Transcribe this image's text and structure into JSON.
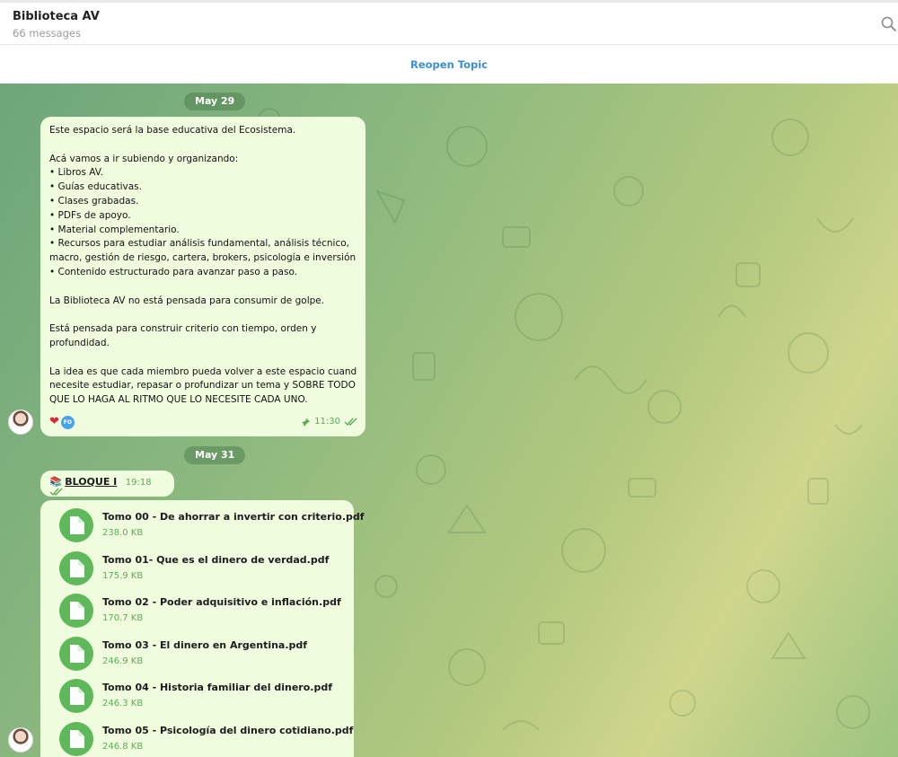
{
  "header": {
    "title": "Biblioteca AV",
    "subtitle": "66 messages"
  },
  "topic": {
    "reopen_label": "Reopen Topic"
  },
  "dates": [
    "May 29",
    "May 31"
  ],
  "message1": {
    "lines": [
      "Este espacio será la base educativa del Ecosistema.",
      "",
      "Acá vamos a ir subiendo y organizando:",
      "• Libros AV.",
      "• Guías educativas.",
      "• Clases grabadas.",
      "• PDFs de apoyo.",
      "• Material complementario.",
      "• Recursos para estudiar análisis fundamental, análisis técnico,",
      "macro, gestión de riesgo, cartera, brokers, psicología e inversión.",
      "• Contenido estructurado para avanzar paso a paso.",
      "",
      "La Biblioteca AV no está pensada para consumir de golpe.",
      "",
      "Está pensada para construir criterio con tiempo, orden y",
      "profundidad.",
      "",
      "La idea es que cada miembro pueda volver a este espacio cuando",
      "necesite estudiar, repasar o profundizar un tema y SOBRE TODO",
      "QUE LO HAGA AL RITMO QUE LO NECESITE CADA UNO."
    ],
    "reaction_badge": "FO",
    "time": "11:30"
  },
  "message2": {
    "text": "BLOQUE I",
    "time": "19:18"
  },
  "files": [
    {
      "name": "Tomo 00 - De ahorrar a invertir con criterio.pdf",
      "size": "238.0 KB"
    },
    {
      "name": "Tomo 01- Que es el dinero de verdad.pdf",
      "size": "175.9 KB"
    },
    {
      "name": "Tomo 02 - Poder adquisitivo e inflación.pdf",
      "size": "170.7 KB"
    },
    {
      "name": "Tomo 03 - El dinero en Argentina.pdf",
      "size": "246.9 KB"
    },
    {
      "name": "Tomo 04 - Historia familiar del dinero.pdf",
      "size": "246.3 KB"
    },
    {
      "name": "Tomo 05 - Psicología del dinero cotidiano.pdf",
      "size": "246.8 KB"
    }
  ],
  "colors": {
    "accent": "#3a8fd6",
    "bubble": "#effdde",
    "file_icon": "#5fb85a",
    "meta_green": "#5bab54"
  }
}
